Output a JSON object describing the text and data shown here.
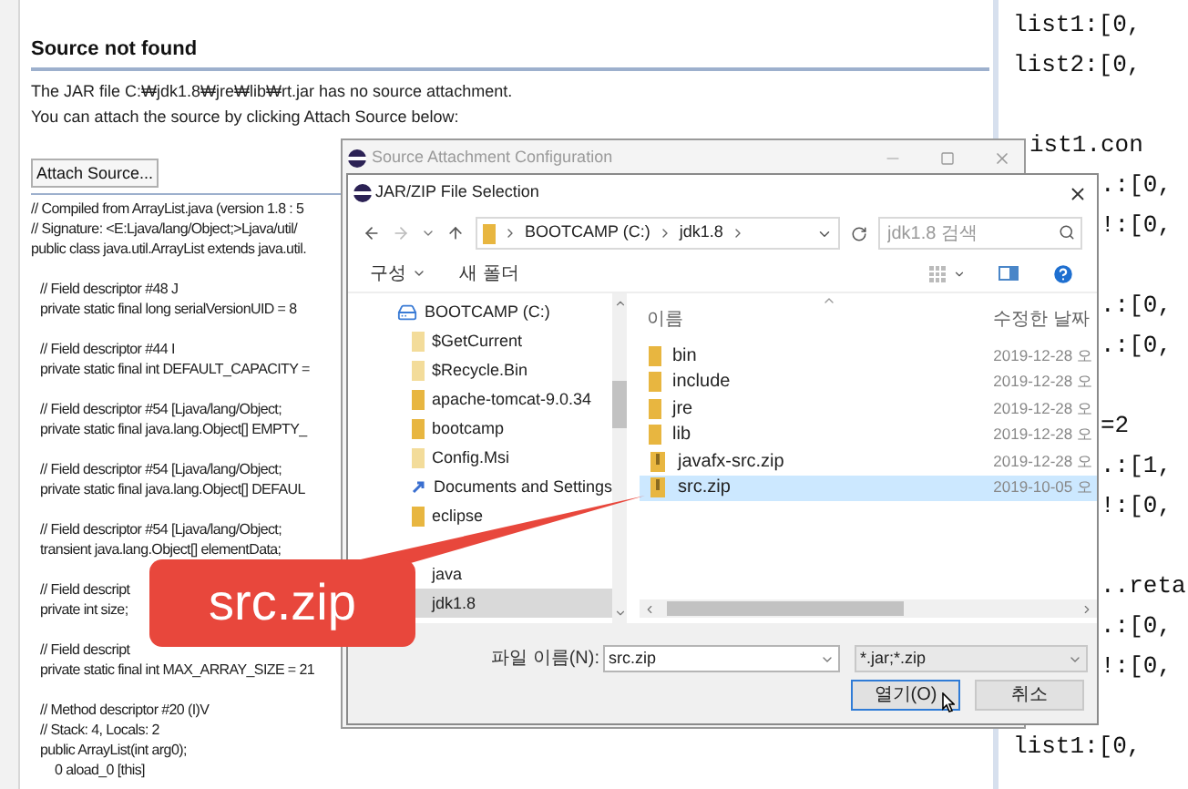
{
  "editor": {
    "heading": "Source not found",
    "message_lines": [
      "The JAR file C:₩jdk1.8₩jre₩lib₩rt.jar has no source attachment.",
      "You can attach the source by clicking Attach Source below:"
    ],
    "attach_button": "Attach Source...",
    "code_groups": [
      [
        "// Compiled from ArrayList.java (version 1.8 : 5",
        "// Signature: <E:Ljava/lang/Object;>Ljava/util/",
        "public class java.util.ArrayList extends java.util."
      ],
      [
        "// Field descriptor #48 J",
        "private static final long serialVersionUID = 8"
      ],
      [
        "// Field descriptor #44 I",
        "private static final int DEFAULT_CAPACITY ="
      ],
      [
        "// Field descriptor #54 [Ljava/lang/Object;",
        "private static final java.lang.Object[] EMPTY_"
      ],
      [
        "// Field descriptor #54 [Ljava/lang/Object;",
        "private static final java.lang.Object[] DEFAUL"
      ],
      [
        "// Field descriptor #54 [Ljava/lang/Object;",
        "transient java.lang.Object[] elementData;"
      ],
      [
        "// Field descript",
        "private int size;"
      ],
      [
        "// Field descript",
        "private static final int MAX_ARRAY_SIZE = 21"
      ],
      [
        "// Method descriptor #20 (I)V",
        "// Stack: 4, Locals: 2",
        "public ArrayList(int arg0);"
      ]
    ],
    "instructions": [
      "0  aload_0 [this]"
    ]
  },
  "console": {
    "blocks": [
      [
        {
          "text": "list1:[0,",
          "kind": "clear"
        },
        {
          "text": "list2:[0,",
          "kind": "clear"
        }
      ],
      [
        {
          "text": "ist1.con",
          "kind": "behind_outer"
        },
        {
          "text": ".:[0,",
          "kind": "behind_inner"
        },
        {
          "text": "!:[0,",
          "kind": "behind_inner"
        }
      ],
      [
        {
          "text": ".:[0,",
          "kind": "behind_inner"
        },
        {
          "text": ".:[0,",
          "kind": "behind_inner"
        }
      ],
      [
        {
          "text": "=2",
          "kind": "behind_inner"
        },
        {
          "text": ".:[1,",
          "kind": "behind_inner"
        },
        {
          "text": "!:[0,",
          "kind": "behind_inner"
        }
      ],
      [
        {
          "text": "..reta",
          "kind": "behind_inner"
        },
        {
          "text": ".:[0,",
          "kind": "behind_inner"
        },
        {
          "text": "!:[0,",
          "kind": "behind_inner"
        }
      ],
      [
        {
          "text": "list1:[0,",
          "kind": "clear"
        }
      ]
    ]
  },
  "attachment_dialog": {
    "title": "Source Attachment Configuration"
  },
  "file_dialog": {
    "title": "JAR/ZIP File Selection",
    "breadcrumb": [
      "BOOTCAMP (C:)",
      "jdk1.8"
    ],
    "search": {
      "placeholder": "jdk1.8 검색"
    },
    "toolbar": [
      "구성",
      "새 폴더"
    ],
    "tree": [
      {
        "label": "BOOTCAMP (C:)",
        "kind": "drive",
        "selected": false,
        "children": [
          {
            "label": "$GetCurrent",
            "kind": "folder_faded",
            "selected": false
          },
          {
            "label": "$Recycle.Bin",
            "kind": "folder_faded",
            "selected": false
          },
          {
            "label": "apache-tomcat-9.0.34",
            "kind": "folder",
            "selected": false
          },
          {
            "label": "bootcamp",
            "kind": "folder",
            "selected": false
          },
          {
            "label": "Config.Msi",
            "kind": "folder_faded",
            "selected": false
          },
          {
            "label": "Documents and Settings",
            "kind": "shortcut",
            "selected": false
          },
          {
            "label": "eclipse",
            "kind": "folder",
            "selected": false
          },
          {
            "label": "java",
            "kind": "covered",
            "selected": false
          },
          {
            "label": "jdk1.8",
            "kind": "covered",
            "selected": true
          }
        ]
      }
    ],
    "columns": [
      "이름",
      "수정한 날짜"
    ],
    "files": [
      {
        "name": "bin",
        "date": "2019-12-28 오",
        "kind": "folder",
        "selected": false
      },
      {
        "name": "include",
        "date": "2019-12-28 오",
        "kind": "folder",
        "selected": false
      },
      {
        "name": "jre",
        "date": "2019-12-28 오",
        "kind": "folder",
        "selected": false
      },
      {
        "name": "lib",
        "date": "2019-12-28 오",
        "kind": "folder",
        "selected": false
      },
      {
        "name": "javafx-src.zip",
        "date": "2019-12-28 오",
        "kind": "zip",
        "selected": false
      },
      {
        "name": "src.zip",
        "date": "2019-10-05 오",
        "kind": "zip",
        "selected": true
      }
    ],
    "filename_label": "파일 이름(N):",
    "filename": "src.zip",
    "filter": "*.jar;*.zip",
    "buttons": [
      {
        "label": "열기(O)",
        "default": true
      },
      {
        "label": "취소",
        "default": false
      }
    ]
  },
  "callout": {
    "text": "src.zip"
  }
}
